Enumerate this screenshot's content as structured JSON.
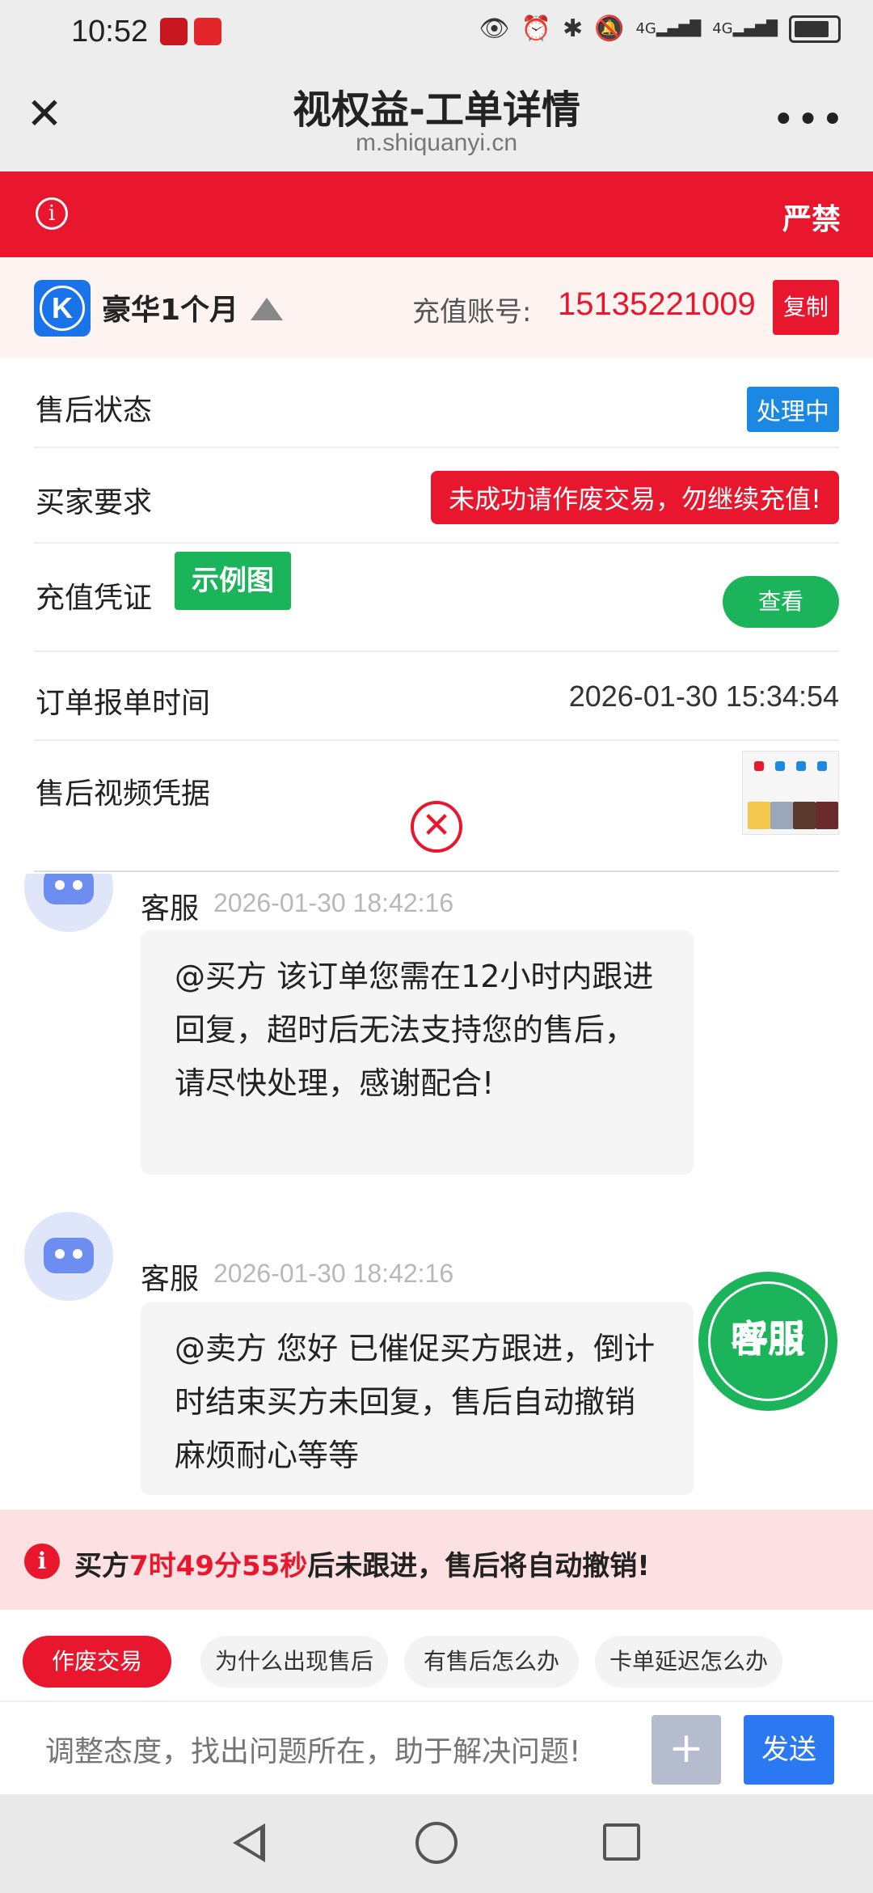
{
  "status_bar": {
    "time": "10:52",
    "network_1": "4G",
    "network_2": "4G",
    "icons": [
      "eye-icon",
      "alarm-icon",
      "bluetooth-icon",
      "mute-icon",
      "signal-icon",
      "signal-icon",
      "battery-icon"
    ]
  },
  "nav": {
    "title": "视权益-工单详情",
    "domain": "m.shiquanyi.cn",
    "more": "•••"
  },
  "notice": {
    "text": "严禁",
    "color": "#e8172d"
  },
  "product": {
    "logo_letter": "K",
    "name": "豪华1个月",
    "account_label": "充值账号:",
    "account_number": "15135221009",
    "copy_label": "复制"
  },
  "details": {
    "status_label": "售后状态",
    "status_value": "处理中",
    "buyer_request_label": "买家要求",
    "buyer_request_value": "未成功请作废交易，勿继续充值!",
    "voucher_label": "充值凭证",
    "example_label": "示例图",
    "view_label": "查看",
    "order_time_label": "订单报单时间",
    "order_time_value": "2026-01-30 15:34:54",
    "video_label": "售后视频凭据"
  },
  "messages": [
    {
      "sender": "客服",
      "time": "2026-01-30 18:42:16",
      "text": "@买方 该订单您需在12小时内跟进回复，超时后无法支持您的售后，请尽快处理，感谢配合!"
    },
    {
      "sender": "客服",
      "time": "2026-01-30 18:42:16",
      "text": "@卖方 您好 已催促买方跟进，倒计时结束买方未回复，售后自动撤销麻烦耐心等等"
    }
  ],
  "call_button": {
    "line1": "呼叫",
    "line2": "客服"
  },
  "warning": {
    "prefix": "买方",
    "countdown": "7时49分55秒",
    "suffix": "后未跟进，售后将自动撤销!"
  },
  "quick_replies": [
    "作废交易",
    "为什么出现售后",
    "有售后怎么办",
    "卡单延迟怎么办"
  ],
  "input": {
    "placeholder": "调整态度，找出问题所在，助于解决问题!",
    "plus": "+",
    "send_label": "发送"
  },
  "colors": {
    "accent_red": "#e8172d",
    "green": "#1bb45a",
    "blue": "#1b88e3",
    "send_blue": "#2b78f0"
  }
}
